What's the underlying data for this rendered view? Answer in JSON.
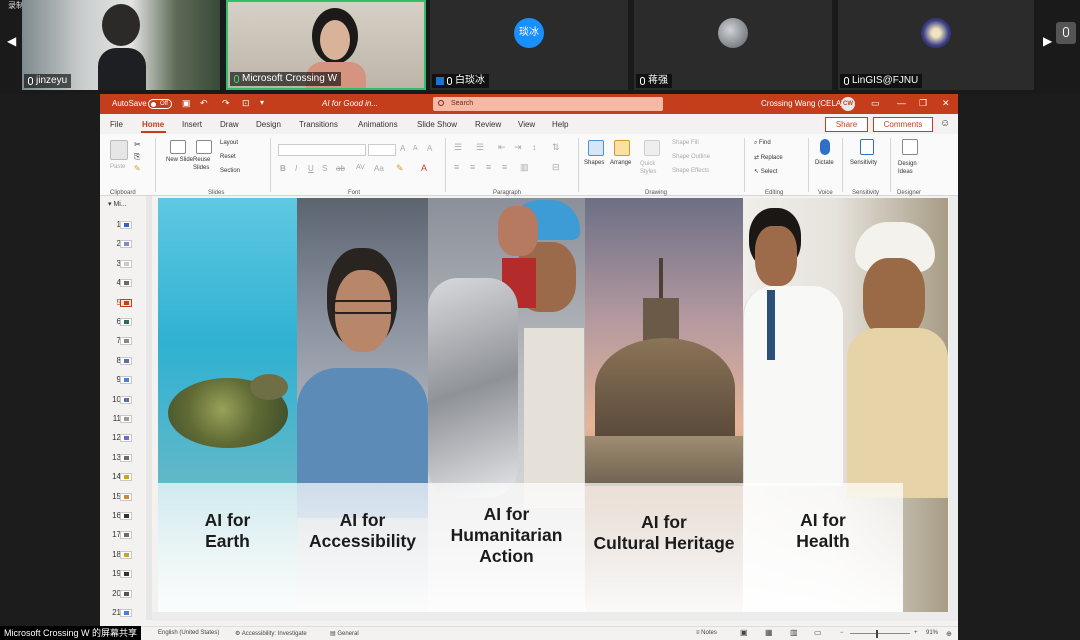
{
  "meeting": {
    "recording_label": "录制中",
    "participants": [
      {
        "name": "jinzeyu"
      },
      {
        "name": "Microsoft Crossing W"
      },
      {
        "name": "白琰冰",
        "avatar_text": "琰冰"
      },
      {
        "name": "蒋强"
      },
      {
        "name": "LinGIS@FJNU"
      }
    ],
    "share_label": "Microsoft Crossing W 的屏幕共享"
  },
  "ppt": {
    "autosave_label": "AutoSave",
    "autosave_state": "Off",
    "doc_title": "AI for Good in...",
    "search_placeholder": "Search",
    "user_name": "Crossing Wang (CELA)",
    "user_initials": "CW",
    "tabs": [
      "File",
      "Home",
      "Insert",
      "Draw",
      "Design",
      "Transitions",
      "Animations",
      "Slide Show",
      "Review",
      "View",
      "Help"
    ],
    "active_tab": "Home",
    "share_label": "Share",
    "comments_label": "Comments",
    "ribbon": {
      "clipboard": {
        "paste": "Paste",
        "group": "Clipboard"
      },
      "slides": {
        "new_slide": "New Slide",
        "reuse_slides": "Reuse Slides",
        "layout": "Layout",
        "reset": "Reset",
        "section": "Section",
        "group": "Slides"
      },
      "font": {
        "group": "Font"
      },
      "paragraph": {
        "group": "Paragraph"
      },
      "drawing": {
        "shapes": "Shapes",
        "arrange": "Arrange",
        "quick_styles": "Quick Styles",
        "shape_fill": "Shape Fill",
        "shape_outline": "Shape Outline",
        "shape_effects": "Shape Effects",
        "group": "Drawing"
      },
      "editing": {
        "find": "Find",
        "replace": "Replace",
        "select": "Select",
        "group": "Editing"
      },
      "voice": {
        "dictate": "Dictate",
        "group": "Voice"
      },
      "sensitivity": {
        "label": "Sensitivity",
        "group": "Sensitivity"
      },
      "designer": {
        "label": "Design Ideas",
        "group": "Designer"
      }
    },
    "thumbnail_header": "Mi...",
    "slide_numbers": [
      "1",
      "2",
      "3",
      "4",
      "5",
      "6",
      "7",
      "8",
      "9",
      "10",
      "11",
      "12",
      "13",
      "14",
      "15",
      "16",
      "17",
      "18",
      "19",
      "20",
      "21"
    ],
    "selected_slide": "5",
    "slide": {
      "panels": [
        {
          "label_line1": "AI for",
          "label_line2": "Earth",
          "label_line3": ""
        },
        {
          "label_line1": "AI for",
          "label_line2": "Accessibility",
          "label_line3": ""
        },
        {
          "label_line1": "AI for",
          "label_line2": "Humanitarian",
          "label_line3": "Action"
        },
        {
          "label_line1": "AI for",
          "label_line2": "Cultural Heritage",
          "label_line3": ""
        },
        {
          "label_line1": "AI for",
          "label_line2": "Health",
          "label_line3": ""
        }
      ]
    },
    "status": {
      "language": "English (United States)",
      "accessibility": "Accessibility: Investigate",
      "sensitivity": "General",
      "notes": "Notes",
      "zoom": "91%"
    }
  },
  "colors": {
    "accent": "#c43e1c",
    "ribbon_bg": "#fafafa",
    "meeting_bg": "#1c1c1c"
  }
}
